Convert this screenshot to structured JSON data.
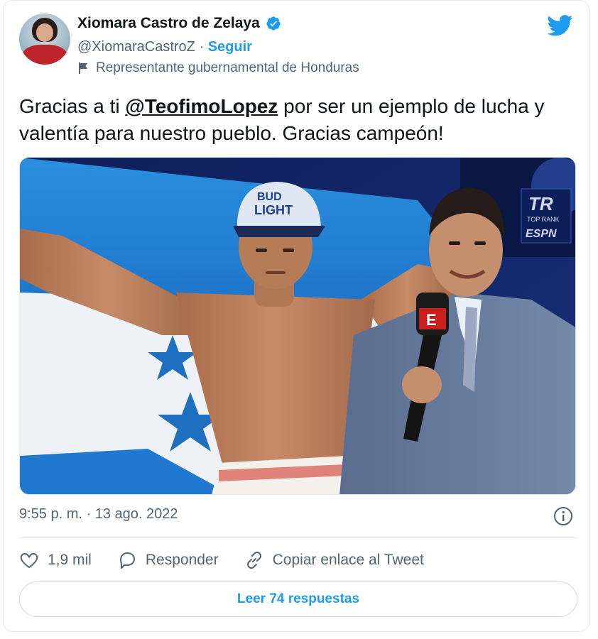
{
  "author": {
    "name": "Xiomara Castro de Zelaya",
    "handle": "@XiomaraCastroZ",
    "separator": "·",
    "follow_label": "Seguir",
    "label": "Representante gubernamental de Honduras"
  },
  "tweet": {
    "text_before": "Gracias a ti ",
    "mention": "@TeofimoLopez",
    "text_after": " por ser un ejemplo de lucha y valentía para nuestro pueblo. Gracias campeón!",
    "timestamp": "9:55 p. m. · 13 ago. 2022"
  },
  "media": {
    "cap_text_1": "BUD",
    "cap_text_2": "LIGHT",
    "banner_top": "TR",
    "banner_mid": "TOP RANK",
    "banner_bottom": "ESPN",
    "mic_letter": "E"
  },
  "actions": {
    "likes": "1,9 mil",
    "reply_label": "Responder",
    "copy_label": "Copiar enlace al Tweet"
  },
  "replies_button": "Leer 74 respuestas",
  "colors": {
    "accent": "#1d9bf0",
    "text": "#0f1419",
    "secondary": "#536471",
    "border": "#e6e9ec"
  },
  "icons": [
    "verified-icon",
    "twitter-bird-icon",
    "government-flag-icon",
    "info-icon",
    "heart-icon",
    "reply-icon",
    "link-icon"
  ]
}
